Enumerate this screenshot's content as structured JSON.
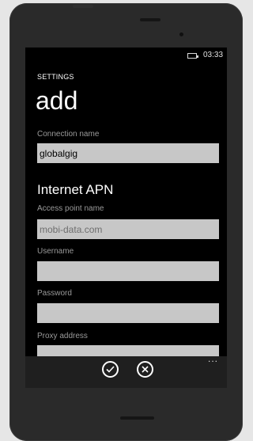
{
  "status_bar": {
    "time": "03:33",
    "battery_icon": "battery-icon"
  },
  "header": {
    "app_title": "SETTINGS",
    "page_title": "add"
  },
  "form": {
    "connection_name": {
      "label": "Connection name",
      "value": "globalgig"
    },
    "section_title": "Internet APN",
    "access_point_name": {
      "label": "Access point name",
      "placeholder": "mobi-data.com"
    },
    "username": {
      "label": "Username",
      "value": ""
    },
    "password": {
      "label": "Password",
      "value": ""
    },
    "proxy_address": {
      "label": "Proxy address",
      "value": ""
    }
  },
  "app_bar": {
    "save_icon": "check-icon",
    "cancel_icon": "close-icon",
    "more_glyph": "..."
  }
}
